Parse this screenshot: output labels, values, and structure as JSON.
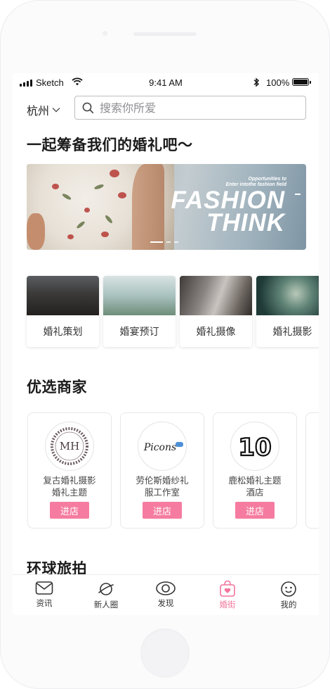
{
  "status_bar": {
    "carrier": "Sketch",
    "time": "9:41 AM",
    "battery": "100%"
  },
  "header": {
    "city": "杭州",
    "search_placeholder": "搜索你所爱"
  },
  "section_main_title": "一起筹备我们的婚礼吧～",
  "banner": {
    "small_line1": "Opportunities to",
    "small_line2": "Enter intothe fashion field",
    "big_line1": "FASHION",
    "big_line2": "THINK",
    "slide_count": 3,
    "active_slide": 1
  },
  "categories": [
    {
      "label": "婚礼策划"
    },
    {
      "label": "婚宴预订"
    },
    {
      "label": "婚礼摄像"
    },
    {
      "label": "婚礼摄影"
    }
  ],
  "merchants_title": "优选商家",
  "merchants": [
    {
      "name_line1": "复古婚礼摄影",
      "name_line2": "婚礼主题",
      "logo_text": "MH",
      "button": "进店"
    },
    {
      "name_line1": "劳伦斯婚纱礼",
      "name_line2": "服工作室",
      "logo_text": "Picons",
      "button": "进店"
    },
    {
      "name_line1": "鹿松婚礼主题",
      "name_line2": "酒店",
      "logo_text": "10",
      "button": "进店"
    }
  ],
  "travel_title": "环球旅拍",
  "tabs": [
    {
      "label": "资讯",
      "icon": "mail-icon"
    },
    {
      "label": "新人圈",
      "icon": "planet-icon"
    },
    {
      "label": "发现",
      "icon": "eye-icon"
    },
    {
      "label": "婚街",
      "icon": "heart-bag-icon",
      "active": true
    },
    {
      "label": "我的",
      "icon": "smiley-icon"
    }
  ],
  "colors": {
    "accent": "#f2739b",
    "button": "#f57ca0"
  }
}
